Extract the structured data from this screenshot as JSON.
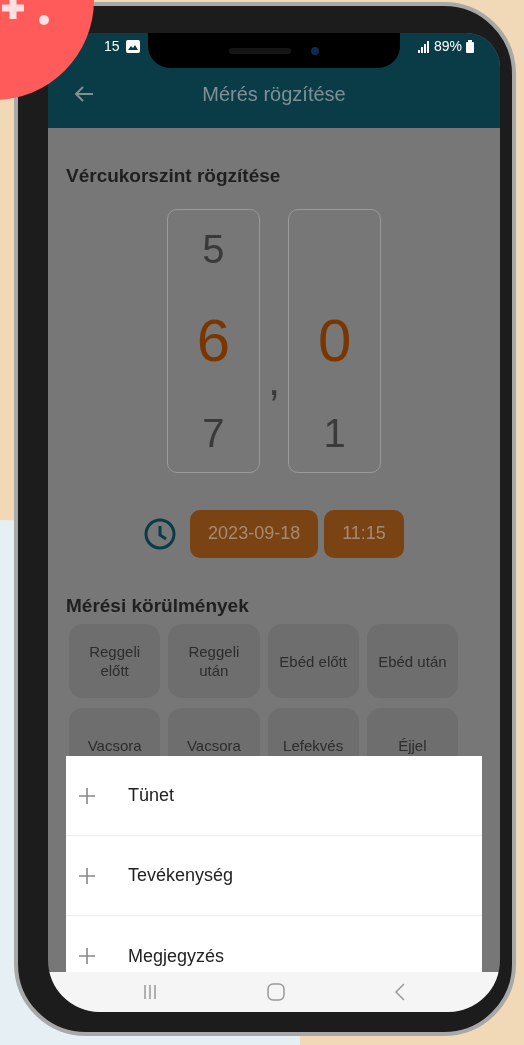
{
  "status_bar": {
    "time": "15",
    "battery": "89%"
  },
  "header": {
    "title": "Mérés rögzítése"
  },
  "section_title": "Vércukorszint rögzítése",
  "picker": {
    "separator": ",",
    "columns": [
      {
        "above": "5",
        "selected": "6",
        "below": "7"
      },
      {
        "selected": "0",
        "below": "1"
      }
    ]
  },
  "datetime": {
    "date": "2023-09-18",
    "time": "11:15"
  },
  "conditions": {
    "title": "Mérési körülmények",
    "options": [
      {
        "label": "Reggeli\nelőtt",
        "selected": false
      },
      {
        "label": "Reggeli\nután",
        "selected": false
      },
      {
        "label": "Ebéd előtt",
        "selected": false
      },
      {
        "label": "Ebéd után",
        "selected": false
      },
      {
        "label": "Vacsora",
        "selected": false
      },
      {
        "label": "Vacsora",
        "selected": false
      },
      {
        "label": "Lefekvés",
        "selected": false
      },
      {
        "label": "Éjjel",
        "selected": false
      }
    ]
  },
  "sheet_items": [
    {
      "label": "Tünet"
    },
    {
      "label": "Tevékenység"
    },
    {
      "label": "Megjegyzés"
    }
  ]
}
